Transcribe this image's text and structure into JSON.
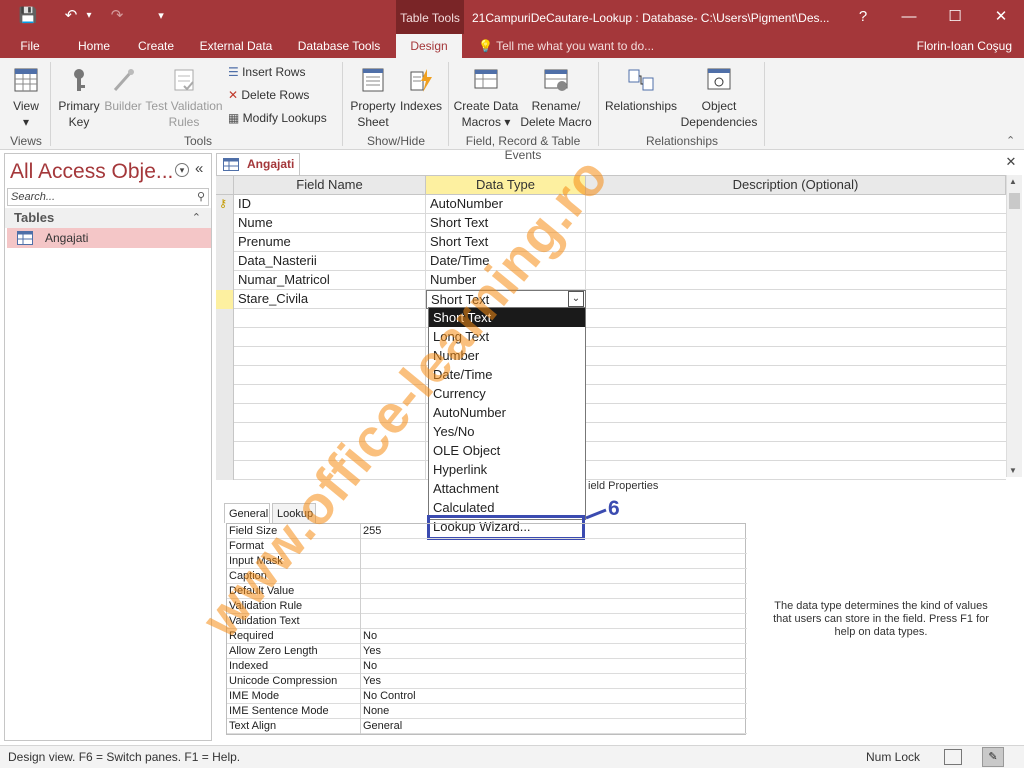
{
  "window": {
    "title": "21CampuriDeCautare-Lookup : Database- C:\\Users\\Pigment\\Des...",
    "contextual_tab": "Table Tools",
    "help": "?",
    "minimize": "—",
    "maximize": "☐",
    "close": "✕"
  },
  "qat": {
    "save": "💾",
    "undo": "↶",
    "redo": "↷",
    "customize": "▾"
  },
  "tabs": [
    "File",
    "Home",
    "Create",
    "External Data",
    "Database Tools",
    "Design"
  ],
  "tellme": "Tell me what you want to do...",
  "user": "Florin-Ioan Coşug",
  "ribbon": {
    "view": "View",
    "primary_key_1": "Primary",
    "primary_key_2": "Key",
    "builder": "Builder",
    "test_1": "Test Validation",
    "test_2": "Rules",
    "insert_rows": "Insert Rows",
    "delete_rows": "Delete Rows",
    "modify_lookups": "Modify Lookups",
    "property_1": "Property",
    "property_2": "Sheet",
    "indexes": "Indexes",
    "create_macros_1": "Create Data",
    "create_macros_2": "Macros ▾",
    "rename_macro_1": "Rename/",
    "rename_macro_2": "Delete Macro",
    "relationships": "Relationships",
    "obj_dep_1": "Object",
    "obj_dep_2": "Dependencies",
    "groups": {
      "views": "Views",
      "tools": "Tools",
      "show_hide": "Show/Hide",
      "field_events": "Field, Record & Table Events",
      "relationships": "Relationships"
    }
  },
  "nav": {
    "title": "All Access Obje...",
    "search": "Search...",
    "category": "Tables",
    "item": "Angajati"
  },
  "doc_tab": "Angajati",
  "grid": {
    "headers": [
      "Field Name",
      "Data Type",
      "Description (Optional)"
    ],
    "rows": [
      {
        "name": "ID",
        "type": "AutoNumber"
      },
      {
        "name": "Nume",
        "type": "Short Text"
      },
      {
        "name": "Prenume",
        "type": "Short Text"
      },
      {
        "name": "Data_Nasterii",
        "type": "Date/Time"
      },
      {
        "name": "Numar_Matricol",
        "type": "Number"
      },
      {
        "name": "Stare_Civila",
        "type": "Short Text"
      }
    ]
  },
  "dropdown": [
    "Short Text",
    "Long Text",
    "Number",
    "Date/Time",
    "Currency",
    "AutoNumber",
    "Yes/No",
    "OLE Object",
    "Hyperlink",
    "Attachment",
    "Calculated",
    "Lookup Wizard..."
  ],
  "annotation": "6",
  "field_properties_label": "ield Properties",
  "prop_tabs": [
    "General",
    "Lookup"
  ],
  "properties": [
    {
      "name": "Field Size",
      "value": "255"
    },
    {
      "name": "Format",
      "value": ""
    },
    {
      "name": "Input Mask",
      "value": ""
    },
    {
      "name": "Caption",
      "value": ""
    },
    {
      "name": "Default Value",
      "value": ""
    },
    {
      "name": "Validation Rule",
      "value": ""
    },
    {
      "name": "Validation Text",
      "value": ""
    },
    {
      "name": "Required",
      "value": "No"
    },
    {
      "name": "Allow Zero Length",
      "value": "Yes"
    },
    {
      "name": "Indexed",
      "value": "No"
    },
    {
      "name": "Unicode Compression",
      "value": "Yes"
    },
    {
      "name": "IME Mode",
      "value": "No Control"
    },
    {
      "name": "IME Sentence Mode",
      "value": "None"
    },
    {
      "name": "Text Align",
      "value": "General"
    }
  ],
  "help_text": "The data type determines the kind of values that users can store in the field. Press F1 for help on data types.",
  "status": {
    "text": "Design view.  F6 = Switch panes.  F1 = Help.",
    "numlock": "Num Lock"
  },
  "watermark": "www.office-learning.ro",
  "colors": {
    "accent": "#a4373a",
    "annotation": "#3b4bb0",
    "watermark": "#f58c14"
  }
}
